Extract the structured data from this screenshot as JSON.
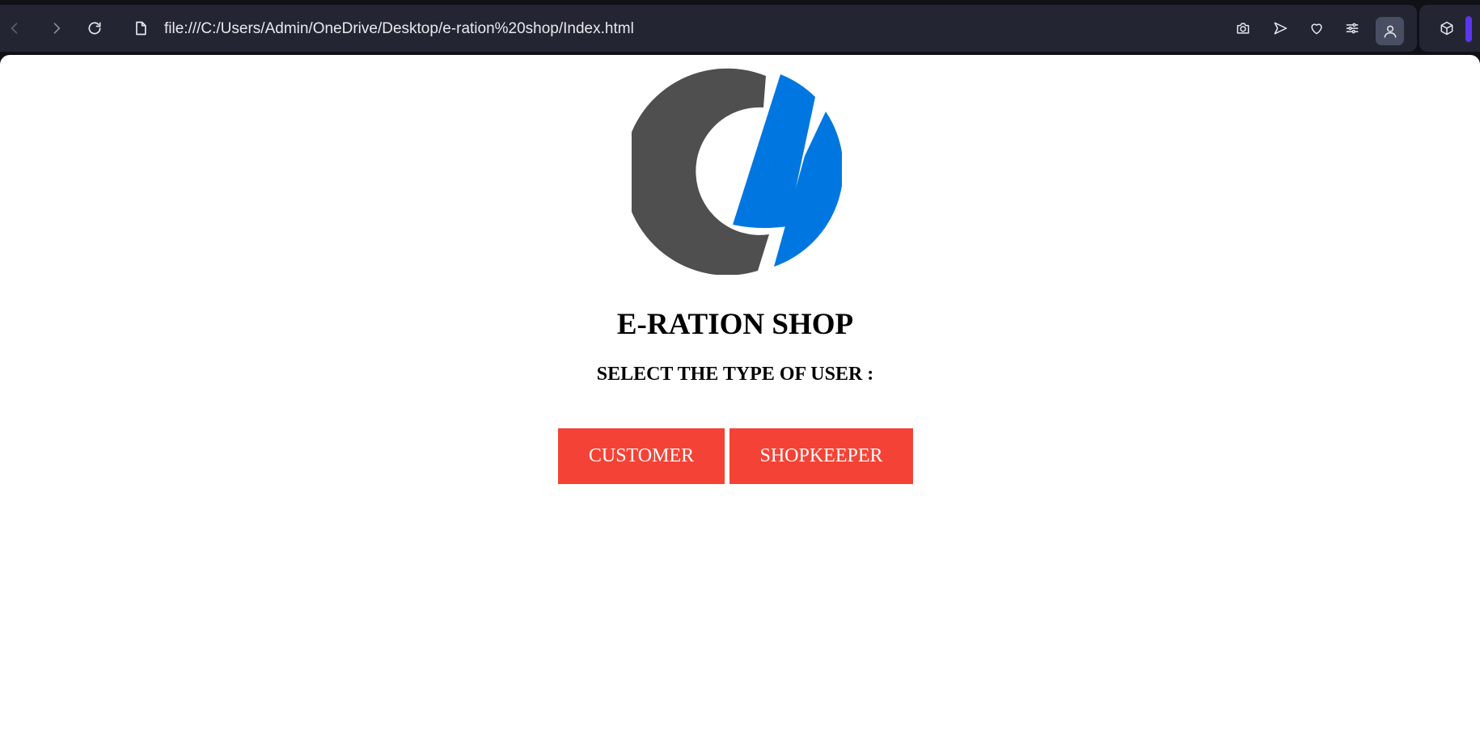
{
  "browser": {
    "url": "file:///C:/Users/Admin/OneDrive/Desktop/e-ration%20shop/Index.html",
    "toolbar_color": "#232632",
    "accent_color": "#5b35f0",
    "icons": [
      "back-icon",
      "forward-icon",
      "reload-icon",
      "file-icon",
      "camera-icon",
      "send-icon",
      "heart-icon",
      "sliders-icon",
      "profile-icon",
      "cube-icon"
    ]
  },
  "page": {
    "title": "E-RATION SHOP",
    "select_label": "SELECT THE TYPE OF USER :",
    "buttons": {
      "customer": "CUSTOMER",
      "shopkeeper": "SHOPKEEPER"
    },
    "button_color": "#f44336",
    "logo_colors": {
      "gray": "#4f4f4f",
      "blue": "#0077e0"
    }
  }
}
